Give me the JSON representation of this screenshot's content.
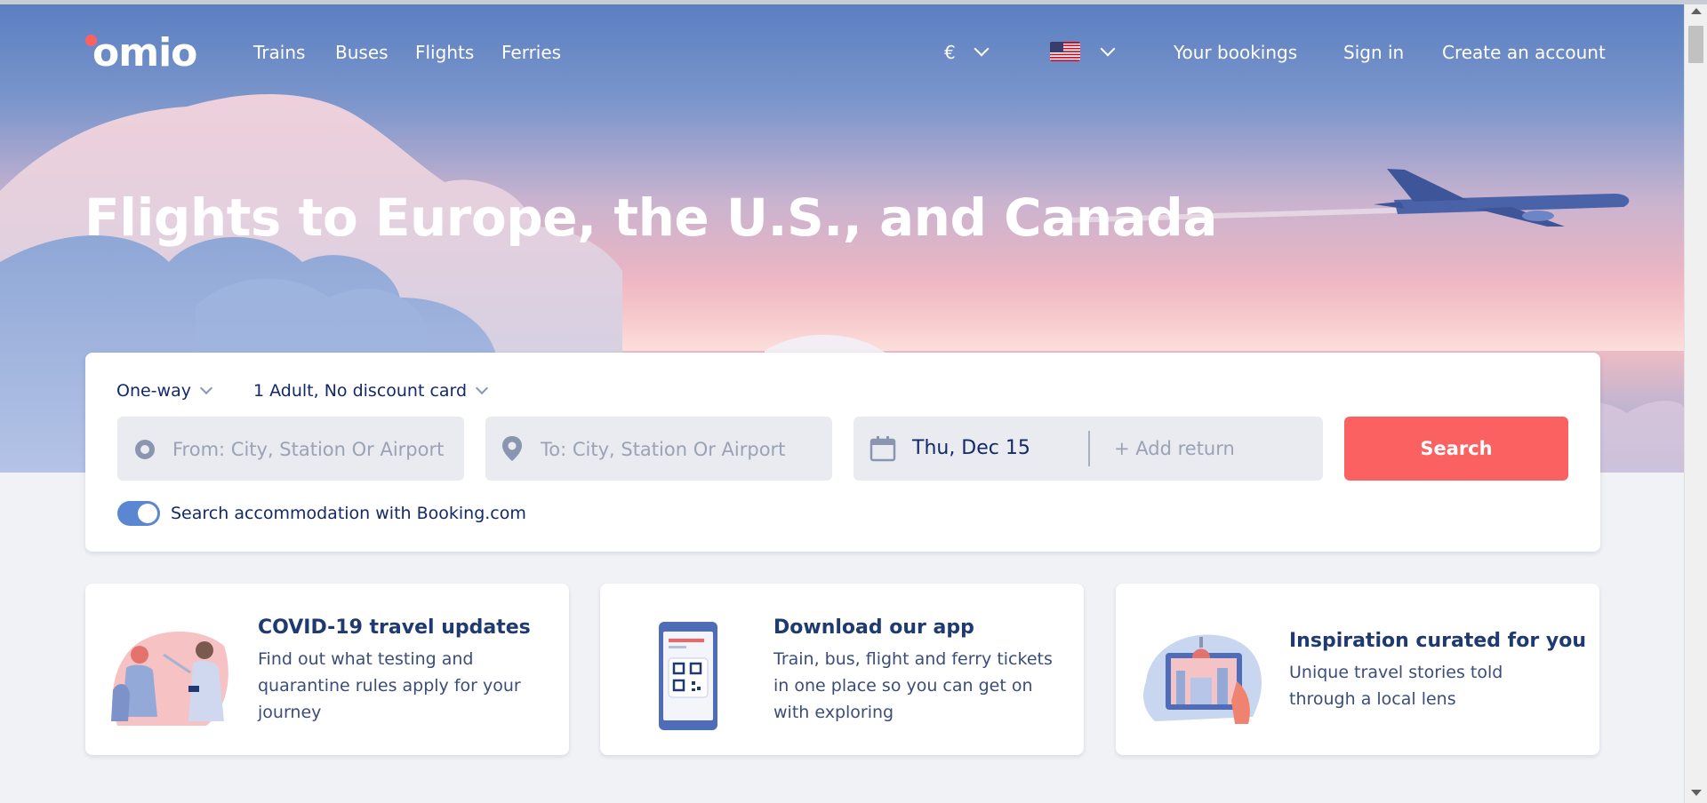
{
  "brand": {
    "logo_text": "omio",
    "coral": "#fc6161",
    "navy": "#132968",
    "toggle_blue": "#5b86d2"
  },
  "nav": {
    "links": [
      "Trains",
      "Buses",
      "Flights",
      "Ferries"
    ],
    "currency": "€",
    "right_links": [
      "Your bookings",
      "Sign in",
      "Create an account"
    ]
  },
  "hero": {
    "title": "Flights to Europe, the U.S., and Canada"
  },
  "search": {
    "trip_type": "One-way",
    "passengers": "1 Adult, No discount card",
    "from_placeholder": "From: City, Station Or Airport",
    "to_placeholder": "To: City, Station Or Airport",
    "date": "Thu, Dec 15",
    "add_return": "+ Add return",
    "search_label": "Search",
    "accommodation_label": "Search accommodation with Booking.com",
    "accommodation_enabled": true
  },
  "cards": [
    {
      "title": "COVID-19 travel updates",
      "text": "Find out what testing and quarantine rules apply for your journey"
    },
    {
      "title": "Download our app",
      "text": "Train, bus, flight and ferry tickets in one place so you can get on with exploring"
    },
    {
      "title": "Inspiration curated for you",
      "text": "Unique travel stories told through a local lens"
    }
  ]
}
